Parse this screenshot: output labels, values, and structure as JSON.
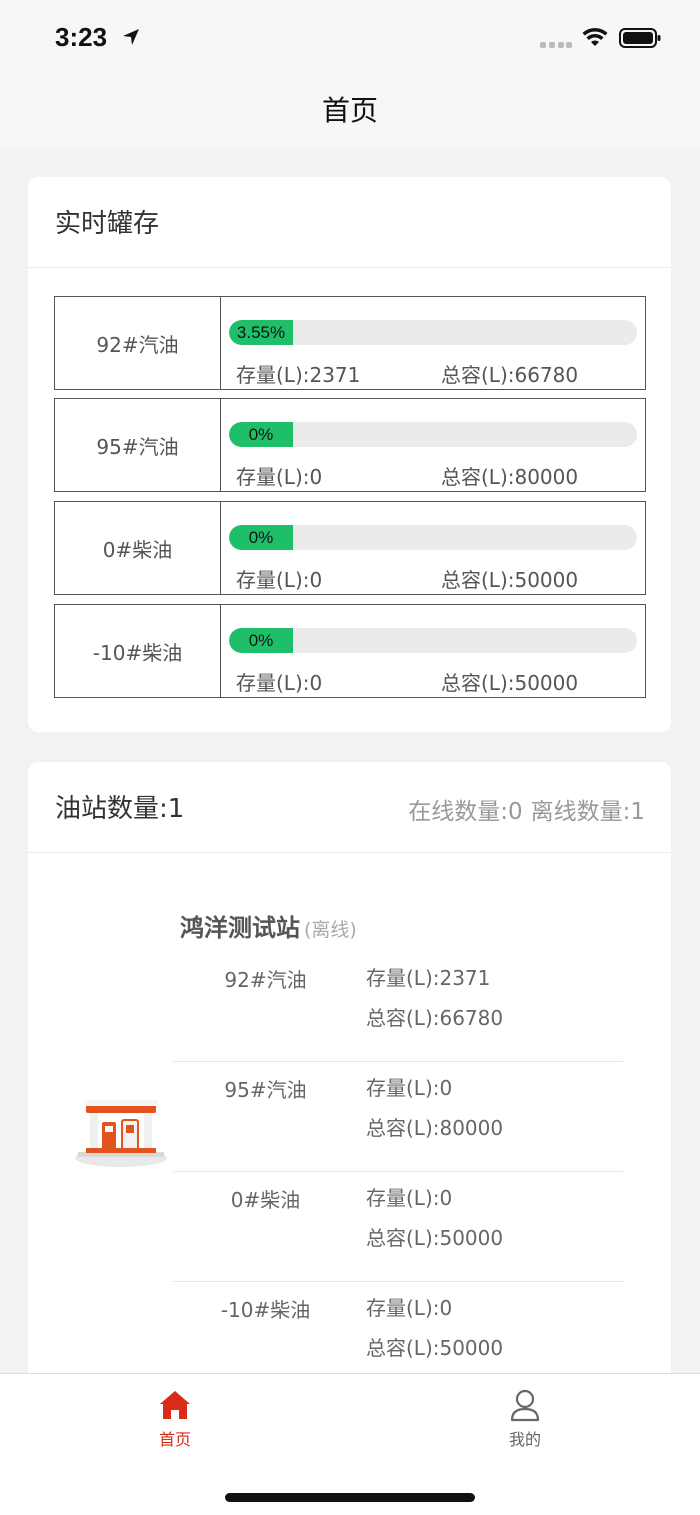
{
  "status_bar": {
    "time": "3:23"
  },
  "nav": {
    "title": "首页"
  },
  "tank_card": {
    "title": "实时罐存",
    "tanks": [
      {
        "name": "92#汽油",
        "percent": "3.55%",
        "fill": 0.0355,
        "stock": "存量(L):2371",
        "capacity": "总容(L):66780"
      },
      {
        "name": "95#汽油",
        "percent": "0%",
        "fill": 0,
        "stock": "存量(L):0",
        "capacity": "总容(L):80000"
      },
      {
        "name": "0#柴油",
        "percent": "0%",
        "fill": 0,
        "stock": "存量(L):0",
        "capacity": "总容(L):50000"
      },
      {
        "name": "-10#柴油",
        "percent": "0%",
        "fill": 0,
        "stock": "存量(L):0",
        "capacity": "总容(L):50000"
      }
    ]
  },
  "station_card": {
    "title": "油站数量:1",
    "online": "在线数量:0",
    "offline": "离线数量:1",
    "station": {
      "name": "鸿洋测试站",
      "status": "(离线)",
      "fuels": [
        {
          "name": "92#汽油",
          "stock": "存量(L):2371",
          "capacity": "总容(L):66780"
        },
        {
          "name": "95#汽油",
          "stock": "存量(L):0",
          "capacity": "总容(L):80000"
        },
        {
          "name": "0#柴油",
          "stock": "存量(L):0",
          "capacity": "总容(L):50000"
        },
        {
          "name": "-10#柴油",
          "stock": "存量(L):0",
          "capacity": "总容(L):50000"
        }
      ]
    }
  },
  "tabbar": {
    "home_label": "首页",
    "mine_label": "我的",
    "active_color": "#d92b16",
    "inactive_color": "#666666"
  },
  "colors": {
    "progress": "#1fbf6a",
    "progress_track": "#ebebeb",
    "brand": "#d92b16"
  }
}
